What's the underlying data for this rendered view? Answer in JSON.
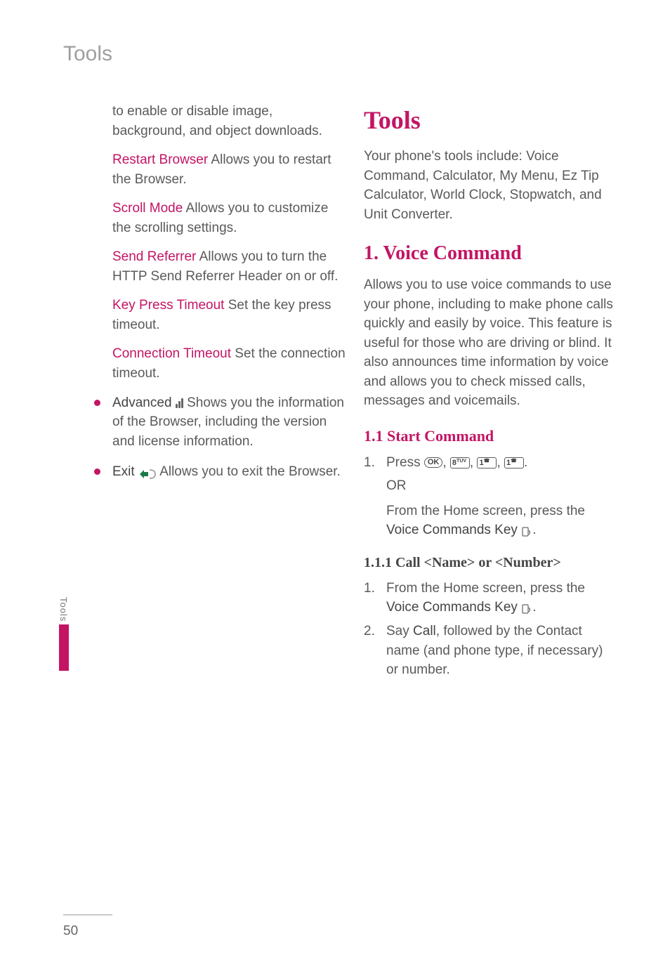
{
  "pageHeader": "Tools",
  "sideTab": "Tools",
  "pageNumber": "50",
  "leftCol": {
    "introFragment": "to enable or disable image, background, and object downloads.",
    "restartTitle": "Restart Browser",
    "restartBody": " Allows you to restart the Browser.",
    "scrollTitle": "Scroll Mode",
    "scrollBody": " Allows you to customize the scrolling settings.",
    "referrerTitle": "Send Referrer",
    "referrerBody": " Allows you to turn the HTTP Send Referrer Header on or off.",
    "keyPressTitle": "Key Press Timeout",
    "keyPressBody": " Set the key press timeout.",
    "connTimeoutTitle": "Connection Timeout",
    "connTimeoutBody": " Set the connection timeout.",
    "advancedTitle": "Advanced ",
    "advancedBody": " Shows you the information of the Browser, including the version and license information.",
    "exitTitle": "Exit ",
    "exitBody": " Allows you to exit the Browser."
  },
  "rightCol": {
    "mainTitle": "Tools",
    "mainIntro": "Your phone's tools include: Voice Command, Calculator, My Menu, Ez Tip Calculator, World Clock, Stopwatch, and Unit Converter.",
    "voiceCmdTitle": "1. Voice Command",
    "voiceCmdBody": "Allows you to use voice commands to use your phone, including to make phone calls quickly and easily by voice. This feature is useful for those who are driving or blind. It also announces time information by voice and allows you to check missed calls, messages and voicemails.",
    "startCmdTitle": "1.1 Start Command",
    "pressNum": "1.",
    "pressText": "Press ",
    "or": "OR",
    "fromHome1a": "From the Home screen, press the ",
    "voiceCommandsKey": "Voice Commands Key ",
    "callNameTitle": "1.1.1 Call <Name> or <Number>",
    "s1num": "1.",
    "s1a": "From the Home screen, press the ",
    "s2num": "2.",
    "s2a": "Say ",
    "s2call": "Call",
    "s2b": ", followed by the Contact name (and phone type, if necessary) or number."
  },
  "keys": {
    "ok": "OK",
    "eight": "8",
    "eightSup": "TUV",
    "one": "1"
  }
}
